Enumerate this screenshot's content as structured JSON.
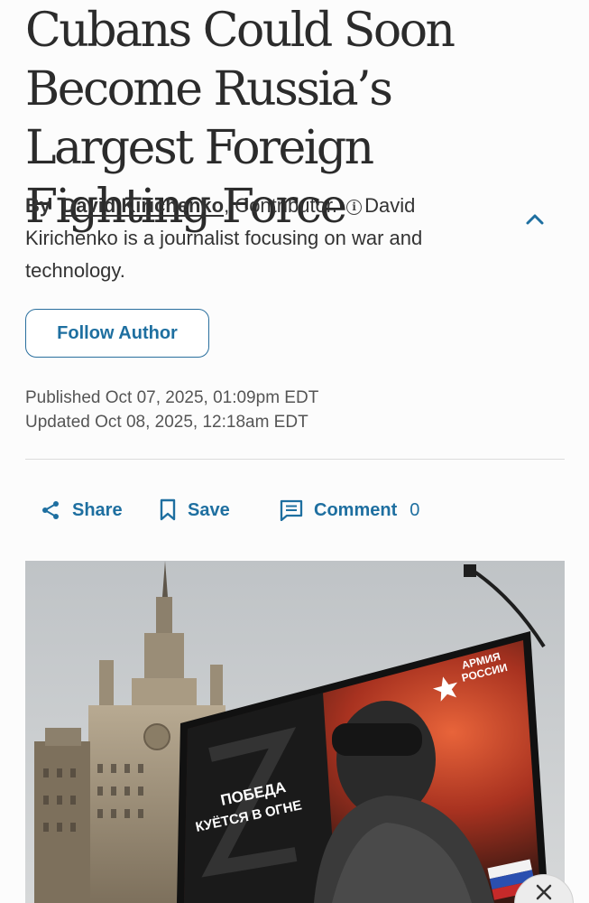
{
  "article": {
    "headline": "Cubans Could Soon Become Russia’s Largest Foreign Fighting Force",
    "byline": {
      "by": "By",
      "author": "David Kirichenko",
      "role": ", Contributor.",
      "bio": "David Kirichenko is a journalist focusing on war and technology."
    },
    "follow_label": "Follow Author",
    "published": "Published Oct 07, 2025, 01:09pm EDT",
    "updated": "Updated Oct 08, 2025, 12:18am EDT"
  },
  "actions": {
    "share_label": "Share",
    "save_label": "Save",
    "comment_label": "Comment",
    "comment_count": "0"
  },
  "hero_image": {
    "billboard_logo_line1": "АРМИЯ",
    "billboard_logo_line2": "РОССИИ",
    "billboard_slogan_line1": "ПОБЕДА",
    "billboard_slogan_line2": "КУЁТСЯ В ОГНЕ"
  },
  "icons": {
    "collapse": "chevron-up-icon",
    "info": "info-icon",
    "share": "share-icon",
    "save": "bookmark-icon",
    "comment": "comment-icon",
    "close": "close-icon"
  },
  "colors": {
    "accent": "#1e6fa0",
    "text": "#2b2b2b"
  }
}
